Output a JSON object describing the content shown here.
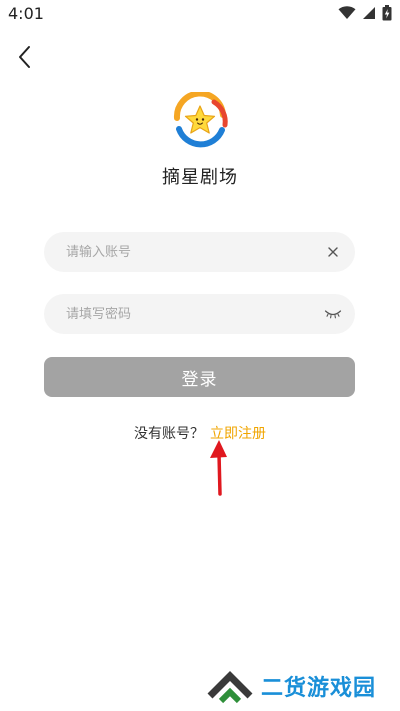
{
  "status_bar": {
    "time": "4:01"
  },
  "app": {
    "name": "摘星剧场"
  },
  "account_field": {
    "value": "",
    "placeholder": "请输入账号"
  },
  "password_field": {
    "value": "",
    "placeholder": "请填写密码"
  },
  "login_button": {
    "label": "登录"
  },
  "register": {
    "prompt": "没有账号？",
    "link_label": "立即注册"
  },
  "watermark": {
    "text": "二货游戏园"
  },
  "colors": {
    "accent": "#f0a500",
    "button_disabled": "#a3a3a3",
    "field_bg": "#f4f4f4",
    "annotation_arrow": "#e0181f",
    "watermark_blue": "#1a8fd8"
  },
  "icons": {
    "back": "chevron-left-icon",
    "clear": "close-icon",
    "password_visibility": "eye-closed-icon",
    "wifi": "wifi-icon",
    "signal": "signal-icon",
    "battery": "battery-charging-icon"
  }
}
